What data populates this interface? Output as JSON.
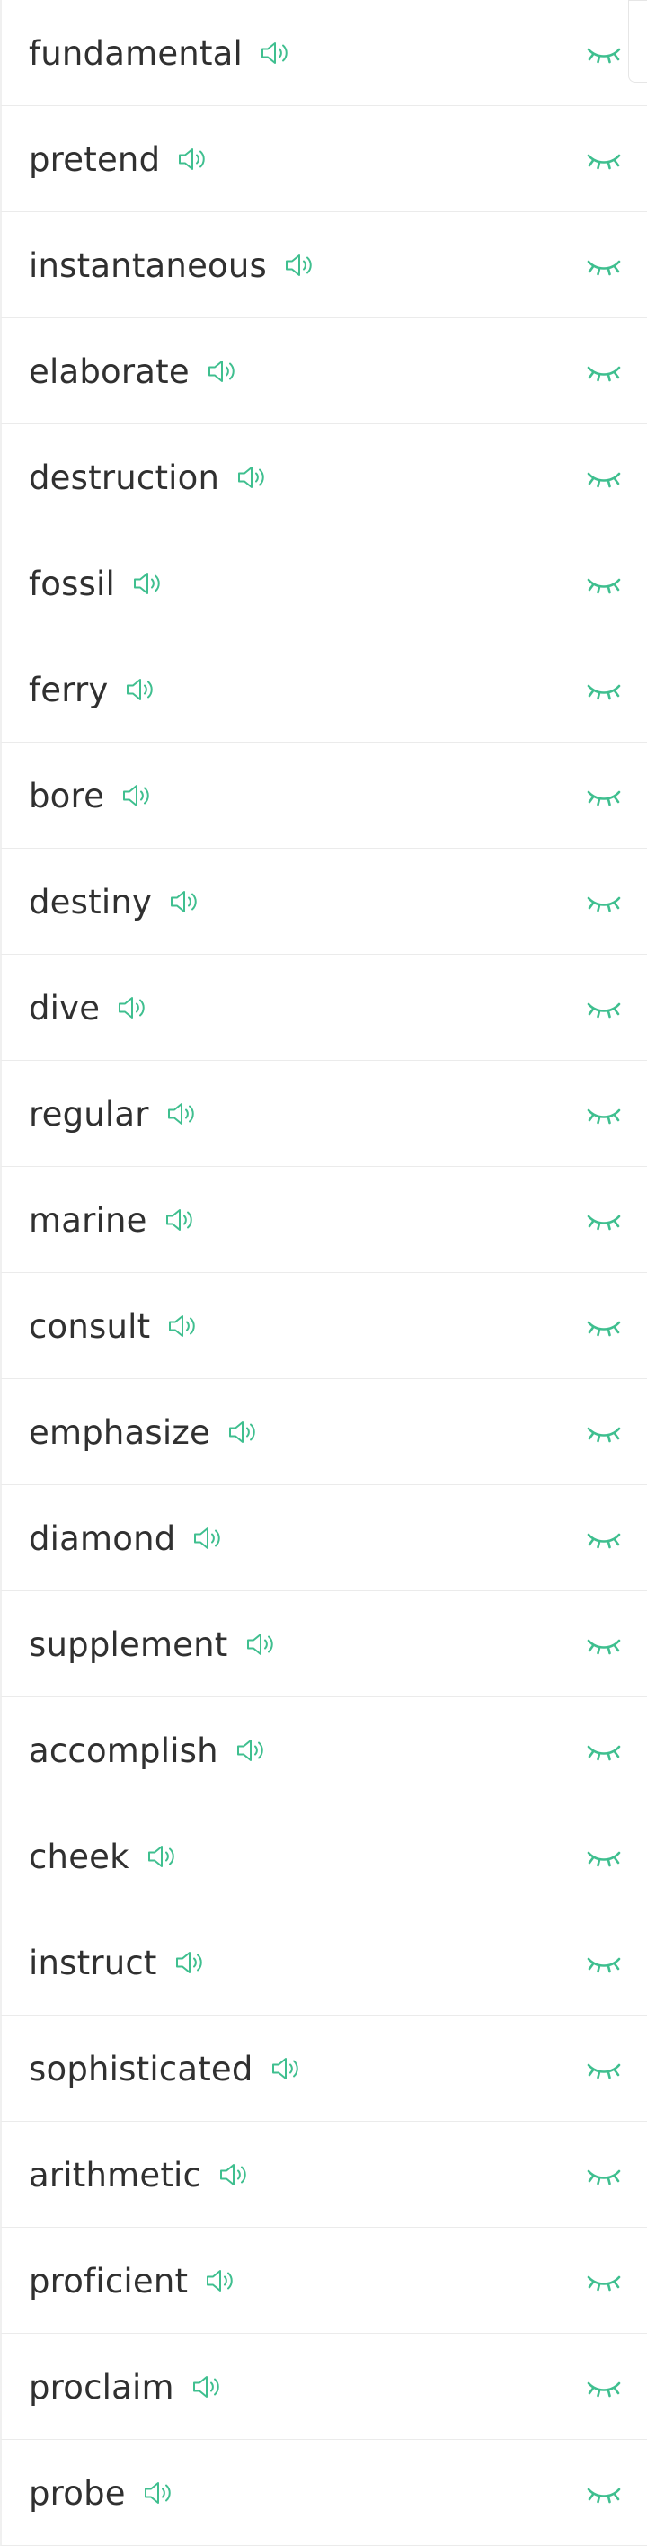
{
  "accent_color": "#3fbf8f",
  "icons": {
    "pronounce": "speaker-icon",
    "reveal": "closed-eye-icon"
  },
  "words": [
    "fundamental",
    "pretend",
    "instantaneous",
    "elaborate",
    "destruction",
    "fossil",
    "ferry",
    "bore",
    "destiny",
    "dive",
    "regular",
    "marine",
    "consult",
    "emphasize",
    "diamond",
    "supplement",
    "accomplish",
    "cheek",
    "instruct",
    "sophisticated",
    "arithmetic",
    "proficient",
    "proclaim",
    "probe"
  ]
}
